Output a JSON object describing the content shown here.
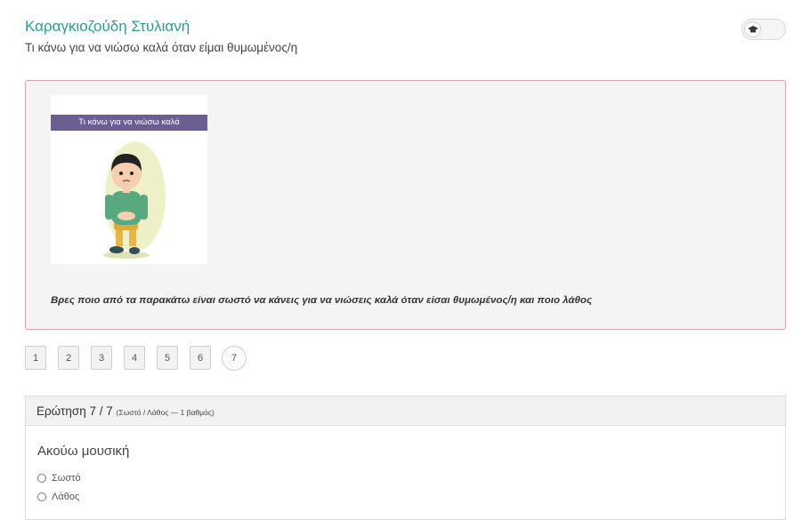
{
  "header": {
    "title": "Καραγκιοζούδη Στυλιανή",
    "subtitle": "Τι κάνω για να νιώσω καλά όταν είμαι θυμωμένος/η",
    "toggle_icon": "graduation-cap-icon"
  },
  "panel": {
    "card_banner": "Τι κάνω για να νιώσω καλά",
    "instruction": "Βρες ποιο από τα παρακάτω είναι σωστό να κάνεις για να νιώσεις καλά όταν είσαι θυμωμένος/η και ποιο λάθος"
  },
  "pagination": {
    "pages": [
      "1",
      "2",
      "3",
      "4",
      "5",
      "6",
      "7"
    ],
    "current": "7"
  },
  "question": {
    "title": "Ερώτηση 7 / 7",
    "meta": "(Σωστό / Λάθος — 1 βαθμός)",
    "text": "Ακούω μουσική",
    "options": [
      "Σωστό",
      "Λάθος"
    ]
  },
  "colors": {
    "title": "#2a9d8f",
    "banner": "#6b5e93",
    "panel_border": "#d9a5ad"
  }
}
